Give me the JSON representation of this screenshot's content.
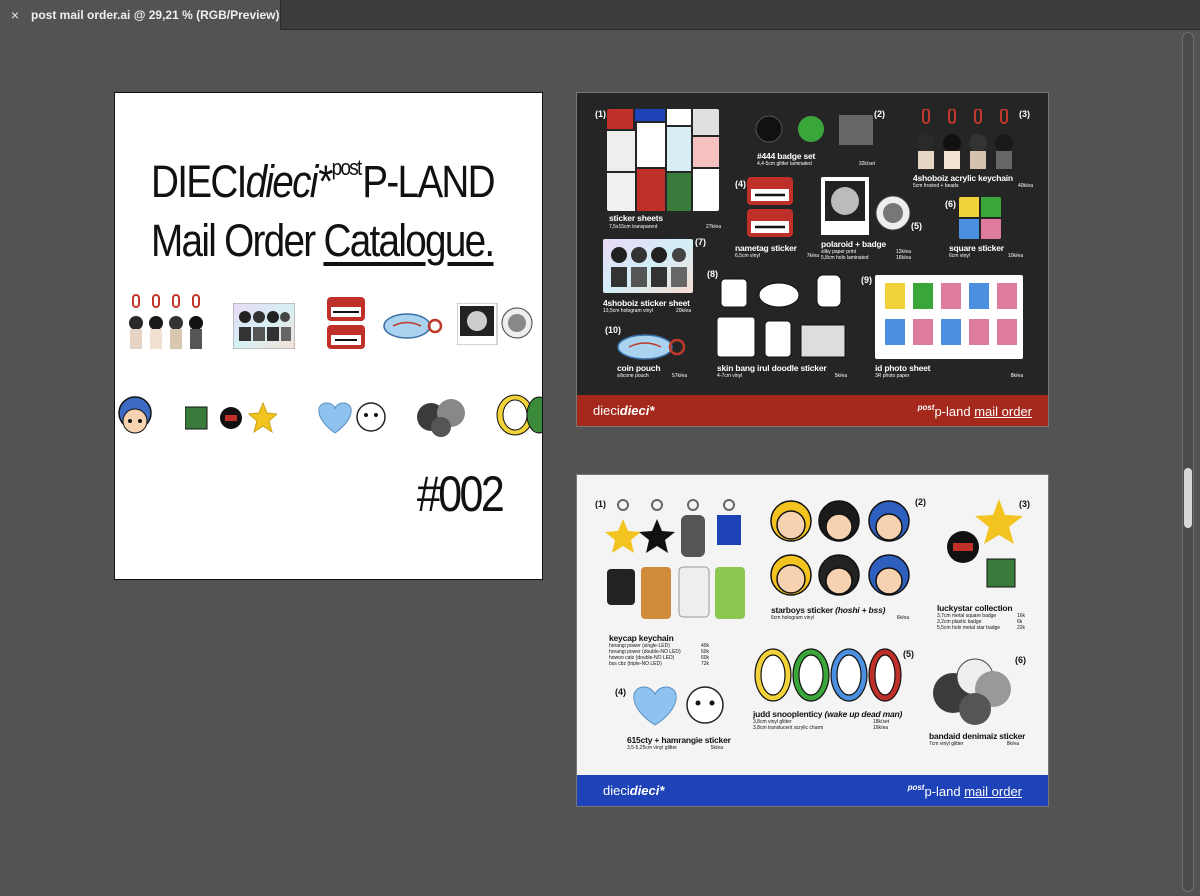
{
  "document": {
    "tab_title": "post mail order.ai @ 29,21 % (RGB/Preview)",
    "close_glyph": "×"
  },
  "colors": {
    "workspace": "#535353",
    "page2_footer": "#a5281c",
    "page3_footer": "#1e43b8",
    "page2_bg": "#252525"
  },
  "cover": {
    "line1_a": "DIECI",
    "line1_b": "dieci*",
    "line1_sup": "post",
    "line1_c": "P-LAND",
    "line2_a": "Mail Order ",
    "line2_b": "Catalogue.",
    "code": "#002"
  },
  "page2": {
    "footer_brand_a": "dieci",
    "footer_brand_b": "dieci*",
    "footer_sup": "post",
    "footer_a": "p-land ",
    "footer_b": "mail order",
    "products": [
      {
        "num": "(1)",
        "name": "sticker sheets",
        "desc": "7,5x15cm transparent",
        "price": "27k/ea"
      },
      {
        "num": "(2)",
        "name": "#444 badge set",
        "desc": "4,4-5cm glitter laminated",
        "price": "32k/set"
      },
      {
        "num": "(3)",
        "name": "4shoboiz acrylic keychain",
        "desc": "5cm frosted + beads",
        "price": "40k/ea"
      },
      {
        "num": "(4)",
        "name": "nametag sticker",
        "desc": "6,5cm vinyl",
        "price": "7k/ea"
      },
      {
        "num": "(5)",
        "name": "polaroid + badge",
        "desc": "silky paper print",
        "desc2": "5,8cm holo laminated",
        "price": "12k/ea",
        "price2": "16k/ea"
      },
      {
        "num": "(6)",
        "name": "square sticker",
        "desc": "6cm vinyl",
        "price": "10k/ea"
      },
      {
        "num": "(7)",
        "name": "4shoboiz sticker sheet",
        "desc": "13,5cm hologram vinyl",
        "price": "20k/ea"
      },
      {
        "num": "(8)",
        "name": "skin bang irul doodle sticker",
        "desc": "4-7cm vinyl",
        "price": "5k/ea"
      },
      {
        "num": "(9)",
        "name": "id photo sheet",
        "desc": "3R photo paper",
        "price": "8k/ea"
      },
      {
        "num": "(10)",
        "name": "coin pouch",
        "desc": "silicone pouch",
        "price": "57k/ea"
      }
    ]
  },
  "page3": {
    "footer_brand_a": "dieci",
    "footer_brand_b": "dieci*",
    "footer_sup": "post",
    "footer_a": "p-land ",
    "footer_b": "mail order",
    "products": [
      {
        "num": "(1)",
        "name": "keycap keychain",
        "rows": [
          {
            "label": "horangi power (single-LED)",
            "price": "40k"
          },
          {
            "label": "horangi power (double-NO LED)",
            "price": "60k"
          },
          {
            "label": "howoo catz (double-NO LED)",
            "price": "60k"
          },
          {
            "label": "bss cbz (triple-NO LED)",
            "price": "72k"
          }
        ]
      },
      {
        "num": "(2)",
        "name": "starboys sticker ",
        "name_i": "(hoshi + bss)",
        "desc": "6cm hologram vinyl",
        "price": "6k/ea"
      },
      {
        "num": "(3)",
        "name": "luckystar collection",
        "rows": [
          {
            "label": "3,7cm metal square badge",
            "price": "16k"
          },
          {
            "label": "3,2cm plastic badge",
            "price": "6k"
          },
          {
            "label": "5,5cm holo metal star badge",
            "price": "22k"
          }
        ]
      },
      {
        "num": "(4)",
        "name": "615cty + hamrangie sticker",
        "desc": "3,5-5,25cm vinyl glitter",
        "price": "5k/ea"
      },
      {
        "num": "(5)",
        "name": "judd snooplenticy ",
        "name_i": "(wake up dead man)",
        "rows": [
          {
            "label": "3,8cm vinyl glitter",
            "price": "18k/set"
          },
          {
            "label": "3,8cm translucent acrylic charm",
            "price": "16k/ea"
          }
        ]
      },
      {
        "num": "(6)",
        "name": "bandaid denimaiz sticker",
        "desc": "7cm vinyl glitter",
        "price": "8k/ea"
      }
    ]
  }
}
